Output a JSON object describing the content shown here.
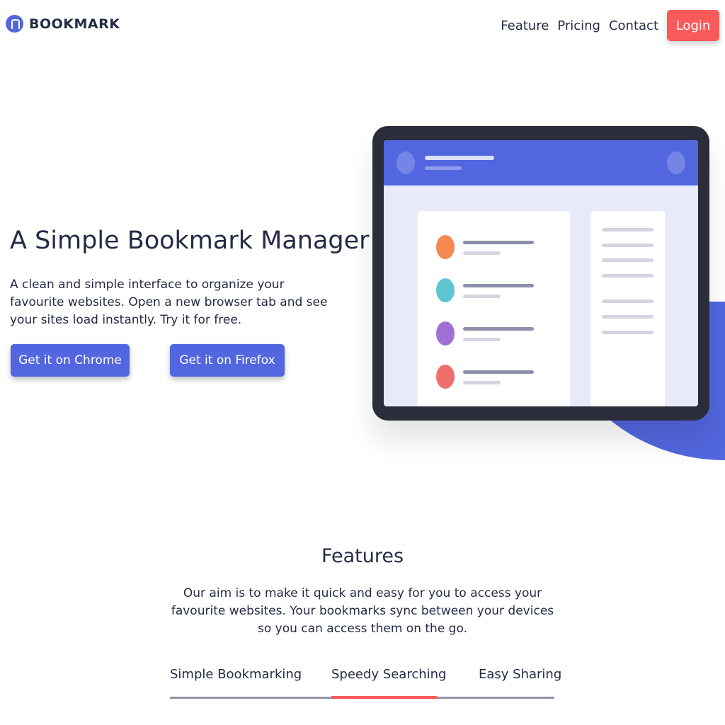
{
  "header": {
    "logo_text": "BOOKMARK",
    "nav": [
      "Feature",
      "Pricing",
      "Contact"
    ],
    "login_label": "Login"
  },
  "hero": {
    "title": "A Simple Bookmark Manager",
    "description": "A clean and simple interface to organize your favourite websites. Open a new browser tab and see your sites load instantly. Try it for free.",
    "chrome_label": "Get it on Chrome",
    "firefox_label": "Get it on Firefox"
  },
  "features": {
    "title": "Features",
    "description": "Our aim is to make it quick and easy for you to access your favourite websites. Your bookmarks sync between your devices so you can access them on the go.",
    "tabs": [
      "Simple Bookmarking",
      "Speedy Searching",
      "Easy Sharing"
    ],
    "active_tab": "Speedy Searching"
  },
  "colors": {
    "primary": "#5267df",
    "accent": "#fa5959",
    "text": "#252b46",
    "dots": [
      "#f5894f",
      "#5fc4d2",
      "#a170d6",
      "#ef6f6d"
    ]
  }
}
